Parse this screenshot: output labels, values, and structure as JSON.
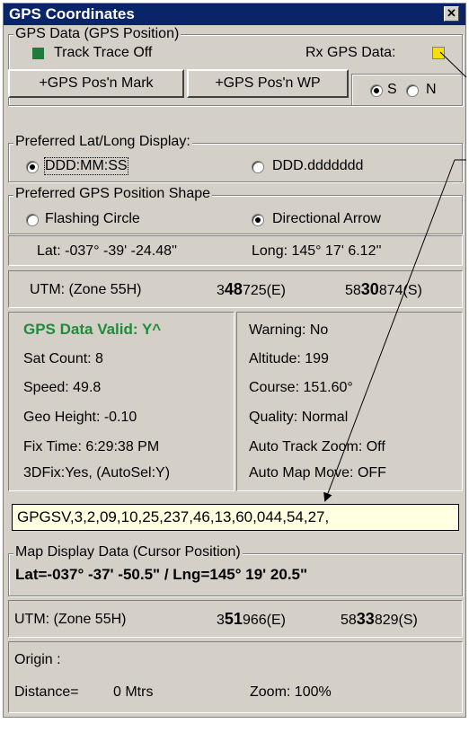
{
  "window": {
    "title": "GPS Coordinates",
    "close_symbol": "✕"
  },
  "gps_data": {
    "legend": "GPS Data (GPS Position)",
    "track_trace": "Track Trace Off",
    "rx_label": "Rx GPS Data:",
    "colors": {
      "track_indicator": "#1e7b3c",
      "rx_indicator": "#f5e000"
    }
  },
  "buttons": {
    "mark": "+GPS Pos'n Mark",
    "wp": "+GPS Pos'n WP"
  },
  "hemisphere": {
    "s": "S",
    "n": "N",
    "selected": "S"
  },
  "latlong_display": {
    "legend": "Preferred Lat/Long Display:",
    "opt1": "DDD:MM:SS",
    "opt2": "DDD.ddddddd",
    "selected": "DDD:MM:SS"
  },
  "shape": {
    "legend": "Preferred GPS Position Shape",
    "opt1": "Flashing Circle",
    "opt2": "Directional Arrow",
    "selected": "Directional Arrow"
  },
  "gps_position": {
    "lat": "Lat: -037° -39' -24.48''",
    "long": "Long: 145° 17' 6.12''",
    "utm_zone": "UTM: (Zone 55H)",
    "easting_pre": "3",
    "easting_bold": "48",
    "easting_post": "725(E)",
    "northing_pre": "58",
    "northing_bold": "30",
    "northing_post": "874(S)"
  },
  "status": {
    "valid": "GPS Data Valid: Y^",
    "sat_count": "Sat Count: 8",
    "speed": "Speed: 49.8",
    "geo_height": "Geo Height: -0.10",
    "fix_time": "Fix Time: 6:29:38 PM",
    "fix": "3DFix:Yes, (AutoSel:Y)",
    "warning": "Warning: No",
    "altitude": "Altitude: 199",
    "course": "Course: 151.60°",
    "quality": "Quality: Normal",
    "auto_zoom": "Auto Track Zoom: Off",
    "auto_move": "Auto Map Move: OFF"
  },
  "nmea": "GPGSV,3,2,09,10,25,237,46,13,60,044,54,27,",
  "map_display": {
    "legend": "Map Display Data (Cursor Position)",
    "latlng": "Lat=-037° -37' -50.5\" / Lng=145° 19' 20.5\"",
    "utm_zone": "UTM: (Zone 55H)",
    "easting_pre": "3",
    "easting_bold": "51",
    "easting_post": "966(E)",
    "northing_pre": "58",
    "northing_bold": "33",
    "northing_post": "829(S)"
  },
  "footer": {
    "origin": "Origin :",
    "distance_label": "Distance=",
    "distance_value": "0 Mtrs",
    "zoom": "Zoom: 100%"
  }
}
